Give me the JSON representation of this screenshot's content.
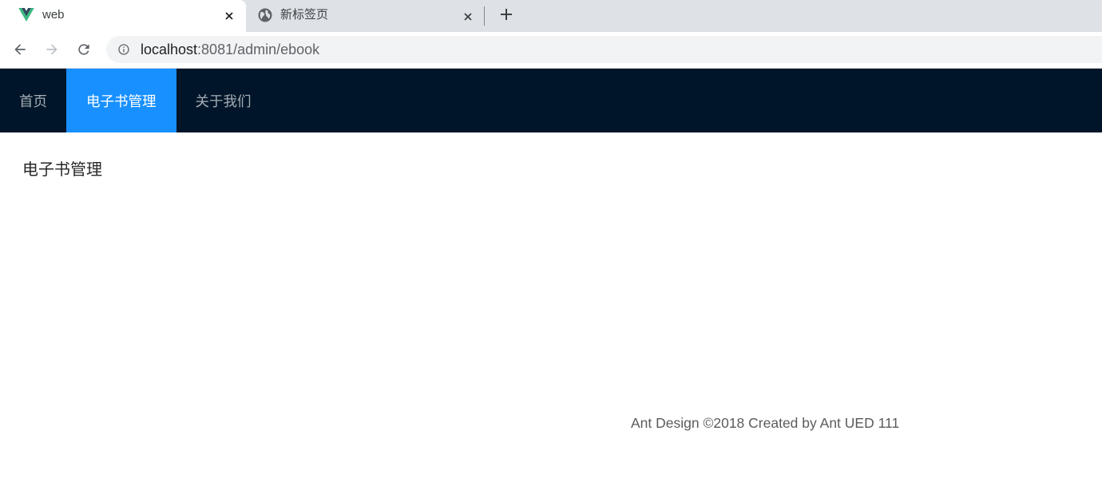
{
  "browser": {
    "tabs": [
      {
        "title": "web",
        "icon": "vue-logo-icon",
        "active": true
      },
      {
        "title": "新标签页",
        "icon": "globe-icon",
        "active": false
      }
    ],
    "toolbar_icons": [
      "back-arrow-icon",
      "forward-arrow-icon",
      "reload-icon",
      "info-icon"
    ],
    "url": {
      "host": "localhost",
      "path": ":8081/admin/ebook"
    }
  },
  "nav": {
    "items": [
      {
        "label": "首页"
      },
      {
        "label": "电子书管理"
      },
      {
        "label": "关于我们"
      }
    ],
    "active_index": 1
  },
  "main": {
    "content_text": "电子书管理"
  },
  "footer": {
    "text": "Ant Design ©2018 Created by Ant UED 111"
  },
  "colors": {
    "nav_background": "#001529",
    "nav_active": "#1890ff",
    "tabstrip_background": "#dee1e6",
    "omnibox_background": "#f1f3f4"
  }
}
